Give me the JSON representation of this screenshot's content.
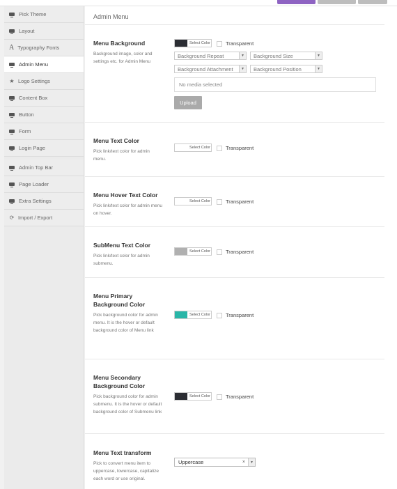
{
  "sidebar": {
    "items": [
      {
        "label": "Pick Theme",
        "icon": "monitor-icon"
      },
      {
        "label": "Layout",
        "icon": "monitor-icon"
      },
      {
        "label": "Typography Fonts",
        "icon": "font-icon"
      },
      {
        "label": "Admin Menu",
        "icon": "monitor-icon",
        "active": true
      },
      {
        "label": "Logo Settings",
        "icon": "star-icon"
      },
      {
        "label": "Content Box",
        "icon": "monitor-icon"
      },
      {
        "label": "Button",
        "icon": "monitor-icon"
      },
      {
        "label": "Form",
        "icon": "monitor-icon"
      },
      {
        "label": "Login Page",
        "icon": "monitor-icon"
      },
      {
        "label": "Admin Top Bar",
        "icon": "monitor-icon"
      },
      {
        "label": "Page Loader",
        "icon": "monitor-icon"
      },
      {
        "label": "Extra Settings",
        "icon": "monitor-icon"
      },
      {
        "label": "Import / Export",
        "icon": "refresh-icon"
      }
    ]
  },
  "page": {
    "title": "Admin Menu"
  },
  "common": {
    "select_color": "Select Color",
    "transparent": "Transparent"
  },
  "menu_background": {
    "title": "Menu Background",
    "desc": "Background image, color and settings etc. for Admin Menu",
    "color": "#2b2d33",
    "selects": [
      "Background Repeat",
      "Background Size",
      "Background Attachment",
      "Background Position"
    ],
    "media_placeholder": "No media selected",
    "upload": "Upload"
  },
  "menu_text_color": {
    "title": "Menu Text Color",
    "desc": "Pick link/text color for admin menu.",
    "color": "#ffffff"
  },
  "menu_hover_text_color": {
    "title": "Menu Hover Text Color",
    "desc": "Pick link/text color for admin menu on hover.",
    "color": "#ffffff"
  },
  "submenu_text_color": {
    "title": "SubMenu Text Color",
    "desc": "Pick link/text color for admin submenu.",
    "color": "#b0b0b0"
  },
  "menu_primary_bg": {
    "title": "Menu Primary Background Color",
    "desc": "Pick background color for admin menu. It is the hover or default background color of Menu link",
    "color": "#29b6a8"
  },
  "menu_secondary_bg": {
    "title": "Menu Secondary Background Color",
    "desc": "Pick background color for admin submenu. It is the hover or default background color of Submenu link",
    "color": "#2b2d33"
  },
  "menu_text_transform": {
    "title": "Menu Text transform",
    "desc": "Pick to convert menu item to uppercase, lowercase, capitalize each word or use original.",
    "value": "Uppercase"
  }
}
